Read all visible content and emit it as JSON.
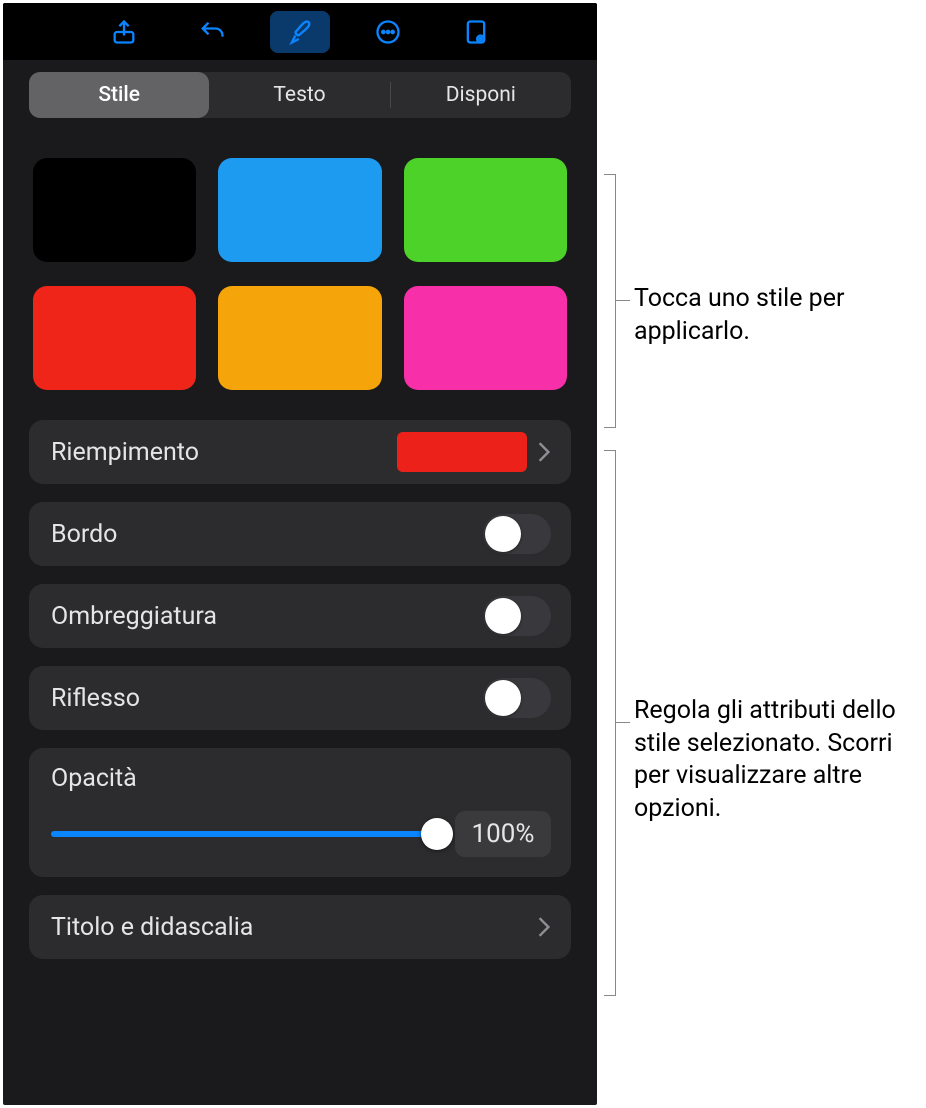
{
  "toolbar": {
    "icons": [
      "share-icon",
      "undo-icon",
      "brush-icon",
      "more-icon",
      "document-icon"
    ],
    "active_index": 2
  },
  "segmented": {
    "items": [
      "Stile",
      "Testo",
      "Disponi"
    ],
    "selected_index": 0
  },
  "style_swatches": [
    {
      "color": "#000000"
    },
    {
      "color": "#1d9bf0"
    },
    {
      "color": "#4cd229"
    },
    {
      "color": "#f02519"
    },
    {
      "color": "#f5a50a"
    },
    {
      "color": "#f72fa8"
    }
  ],
  "options": {
    "fill": {
      "label": "Riempimento",
      "swatch": "#ec221a"
    },
    "border": {
      "label": "Bordo",
      "on": false
    },
    "shadow": {
      "label": "Ombreggiatura",
      "on": false
    },
    "reflection": {
      "label": "Riflesso",
      "on": false
    },
    "opacity": {
      "label": "Opacità",
      "value": "100%",
      "percent": 100
    },
    "title_caption": {
      "label": "Titolo e didascalia"
    }
  },
  "callouts": {
    "c1": "Tocca uno stile per applicarlo.",
    "c2": "Regola gli attributi dello stile selezionato. Scorri per visualizzare altre opzioni."
  }
}
